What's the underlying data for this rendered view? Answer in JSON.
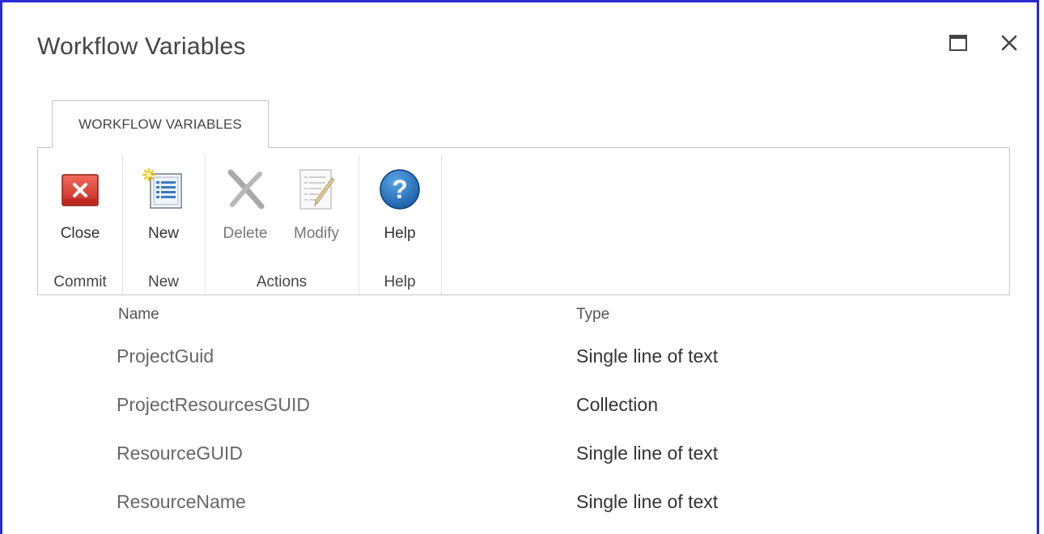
{
  "dialog": {
    "title": "Workflow Variables",
    "maximize_icon": "maximize-icon",
    "close_icon": "close-icon"
  },
  "ribbon": {
    "tab_label": "WORKFLOW VARIABLES",
    "groups": [
      {
        "label": "Commit",
        "buttons": [
          {
            "label": "Close",
            "icon": "close-red-icon",
            "enabled": true
          }
        ]
      },
      {
        "label": "New",
        "buttons": [
          {
            "label": "New",
            "icon": "new-item-icon",
            "enabled": true
          }
        ]
      },
      {
        "label": "Actions",
        "buttons": [
          {
            "label": "Delete",
            "icon": "delete-x-icon",
            "enabled": false
          },
          {
            "label": "Modify",
            "icon": "modify-pencil-icon",
            "enabled": false
          }
        ]
      },
      {
        "label": "Help",
        "buttons": [
          {
            "label": "Help",
            "icon": "help-question-icon",
            "enabled": true
          }
        ]
      }
    ]
  },
  "table": {
    "headers": {
      "name": "Name",
      "type": "Type"
    },
    "rows": [
      {
        "name": "ProjectGuid",
        "type": "Single line of text"
      },
      {
        "name": "ProjectResourcesGUID",
        "type": "Collection"
      },
      {
        "name": "ResourceGUID",
        "type": "Single line of text"
      },
      {
        "name": "ResourceName",
        "type": "Single line of text"
      }
    ]
  },
  "colors": {
    "border": "#2a2ad0",
    "close_red": "#d9342b",
    "help_blue": "#1f6fb8"
  }
}
